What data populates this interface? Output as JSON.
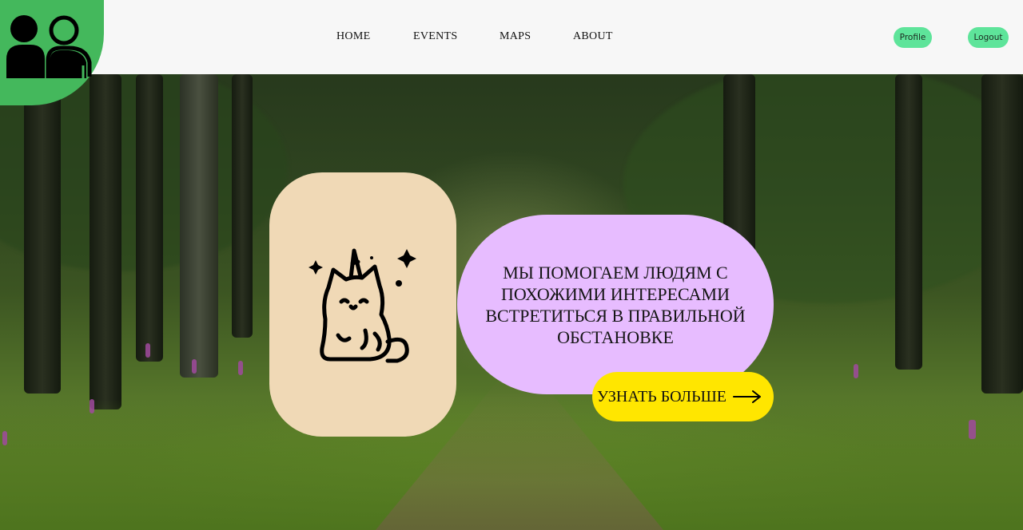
{
  "header": {
    "nav": [
      {
        "label": "HOME"
      },
      {
        "label": "EVENTS"
      },
      {
        "label": "MAPS"
      },
      {
        "label": "ABOUT"
      }
    ],
    "profile_label": "Profile",
    "logout_label": "Logout"
  },
  "hero": {
    "mission_text": "МЫ ПОМОГАЕМ ЛЮДЯМ С ПОХОЖИМИ ИНТЕРЕСАМИ ВСТРЕТИТЬСЯ В ПРАВИЛЬНОЙ ОБСТАНОВКЕ",
    "cta_label": "УЗНАТЬ БОЛЬШЕ",
    "cta_icon": "arrow-right-icon",
    "illustration_icon": "unicorn-cat-icon"
  },
  "logo": {
    "icon": "people-icon"
  },
  "colors": {
    "header_bg": "#f7f7f7",
    "logo_green": "#44b85c",
    "button_green": "#5ee49a",
    "cat_card": "#f0d9b6",
    "text_card": "#e7bcff",
    "cta_yellow": "#ffe600"
  }
}
